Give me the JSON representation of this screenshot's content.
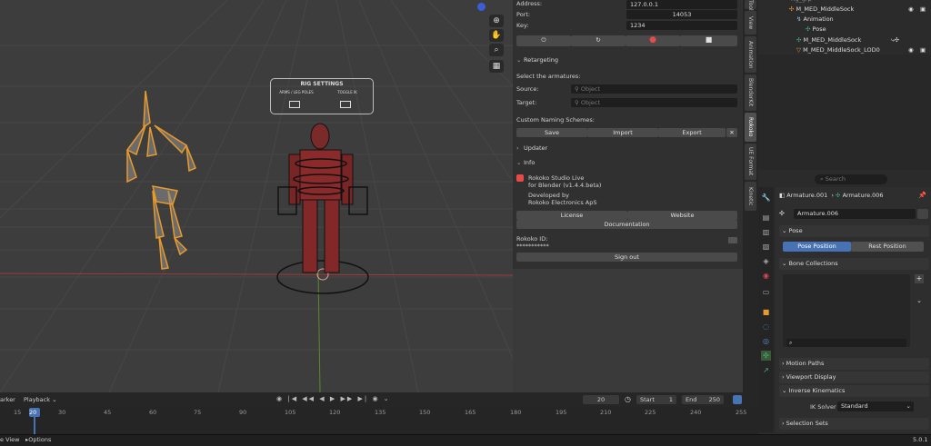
{
  "addon": {
    "address_label": "Address:",
    "address_value": "127.0.0.1",
    "port_label": "Port:",
    "port_value": "14053",
    "key_label": "Key:",
    "key_value": "1234",
    "retargeting_label": "Retargeting",
    "select_armatures_label": "Select the armatures:",
    "source_label": "Source:",
    "target_label": "Target:",
    "object_placeholder": "Object",
    "naming_label": "Custom Naming Schemes:",
    "save_label": "Save",
    "import_label": "Import",
    "export_label": "Export",
    "updater_label": "Updater",
    "info_label": "Info",
    "studio_line1": "Rokoko Studio Live",
    "studio_line2": "for Blender (v1.4.4.beta)",
    "dev_line1": "Developed by",
    "dev_line2": "Rokoko Electronics ApS",
    "license_label": "License",
    "website_label": "Website",
    "documentation_label": "Documentation",
    "rokoko_id_label": "Rokoko ID:",
    "rokoko_id_value": "***********",
    "signout_label": "Sign out"
  },
  "tabs": [
    "Tool",
    "View",
    "Animation",
    "BlenderKit",
    "Rokoko",
    "UE Format",
    "Kinetic"
  ],
  "rig_settings": {
    "title": "RIG SETTINGS",
    "col1": "ARMS / LEG POLES",
    "col2": "TOGGLE IK"
  },
  "outliner": {
    "rows": [
      {
        "label": "rig_grp",
        "indent": 0
      },
      {
        "label": "M_MED_MiddleSock",
        "indent": 0
      },
      {
        "label": "Animation",
        "indent": 1
      },
      {
        "label": "Pose",
        "indent": 1
      },
      {
        "label": "M_MED_MiddleSock",
        "indent": 1
      },
      {
        "label": "M_MED_MiddleSock_LOD0",
        "indent": 1
      }
    ]
  },
  "properties": {
    "search_placeholder": "Search",
    "breadcrumb_armature": "Armature.001",
    "breadcrumb_pose": "Armature.006",
    "object_name": "Armature.006",
    "pose_section": "Pose",
    "pose_position": "Pose Position",
    "rest_position": "Rest Position",
    "bone_collections": "Bone Collections",
    "motion_paths": "Motion Paths",
    "viewport_display": "Viewport Display",
    "inverse_kinematics": "Inverse Kinematics",
    "ik_solver_label": "IK Solver",
    "ik_solver_value": "Standard",
    "selection_sets": "Selection Sets"
  },
  "timeline": {
    "marker_label": "arker",
    "playback_label": "Playback",
    "current_frame": "20",
    "start_label": "Start",
    "start_value": "1",
    "end_label": "End",
    "end_value": "250",
    "ticks": [
      "15",
      "20",
      "30",
      "45",
      "60",
      "75",
      "90",
      "105",
      "120",
      "135",
      "150",
      "165",
      "180",
      "195",
      "210",
      "225",
      "240",
      "255"
    ]
  },
  "statusbar": {
    "left_label": "e View",
    "options_label": "Options",
    "version": "5.0.1"
  },
  "colors": {
    "accent": "#4772b3",
    "bone_orange": "#e89a2c",
    "record_red": "#e84a4a"
  }
}
